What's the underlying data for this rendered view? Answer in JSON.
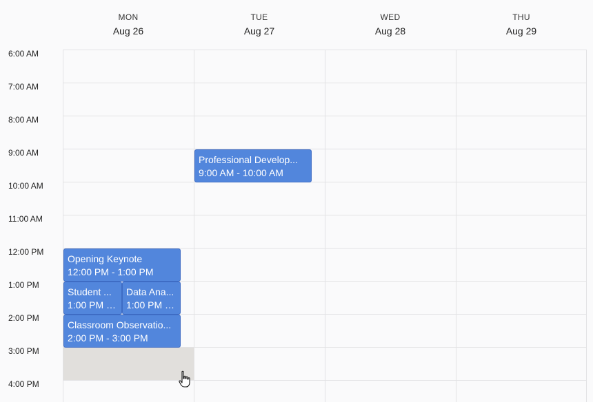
{
  "days": [
    {
      "dow": "MON",
      "date": "Aug 26"
    },
    {
      "dow": "TUE",
      "date": "Aug 27"
    },
    {
      "dow": "WED",
      "date": "Aug 28"
    },
    {
      "dow": "THU",
      "date": "Aug 29"
    }
  ],
  "times": [
    "6:00 AM",
    "7:00 AM",
    "8:00 AM",
    "9:00 AM",
    "10:00 AM",
    "11:00 AM",
    "12:00 PM",
    "1:00 PM",
    "2:00 PM",
    "3:00 PM",
    "4:00 PM"
  ],
  "events": [
    {
      "title": "Professional Develop...",
      "time": "9:00 AM - 10:00 AM"
    },
    {
      "title": "Opening Keynote",
      "time": "12:00 PM - 1:00 PM"
    },
    {
      "title": "Student ...",
      "time": "1:00 PM - ..."
    },
    {
      "title": "Data Ana...",
      "time": "1:00 PM - ..."
    },
    {
      "title": "Classroom Observatio...",
      "time": "2:00 PM - 3:00 PM"
    }
  ],
  "colors": {
    "event_fill": "#5286dc",
    "event_border": "#3e6cc4",
    "hover_slot": "#e1dfdc"
  },
  "cursor_icon": "hand-pointer-icon"
}
